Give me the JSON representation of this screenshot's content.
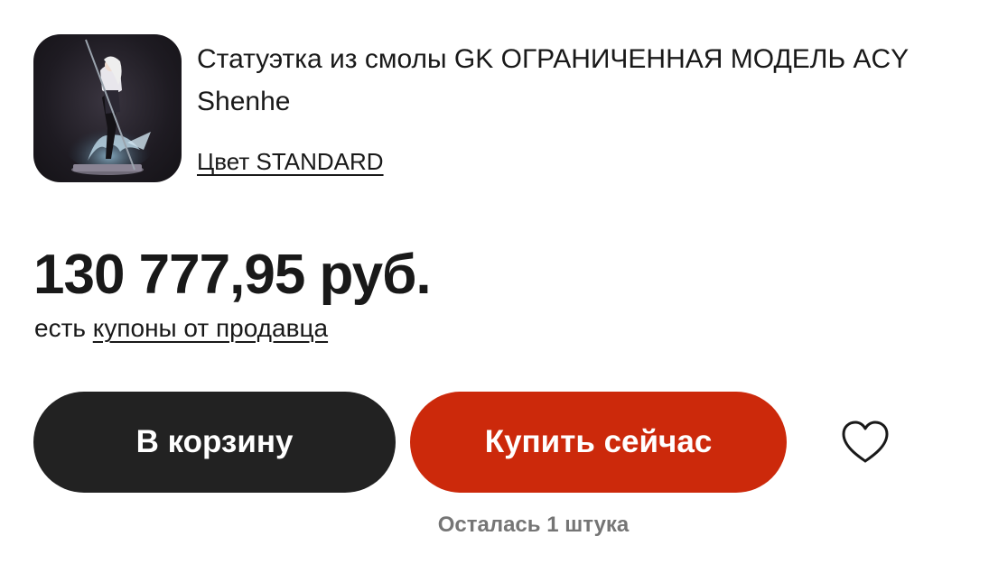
{
  "product": {
    "title": "Статуэтка из смолы GK ОГРАНИЧЕННАЯ МОДЕЛЬ ACY Shenhe",
    "variant_label": "Цвет STANDARD",
    "thumbnail_icon": "figure-statue-image"
  },
  "pricing": {
    "price": "130 777,95 руб.",
    "coupon_prefix": "есть",
    "coupon_link": "купоны от продавца"
  },
  "actions": {
    "add_to_cart_label": "В корзину",
    "buy_now_label": "Купить сейчас",
    "wishlist_icon": "heart-icon"
  },
  "stock": {
    "text": "Осталась 1 штука"
  },
  "colors": {
    "cart_button": "#222222",
    "buy_button": "#cc290b",
    "stock_text": "#757575"
  }
}
